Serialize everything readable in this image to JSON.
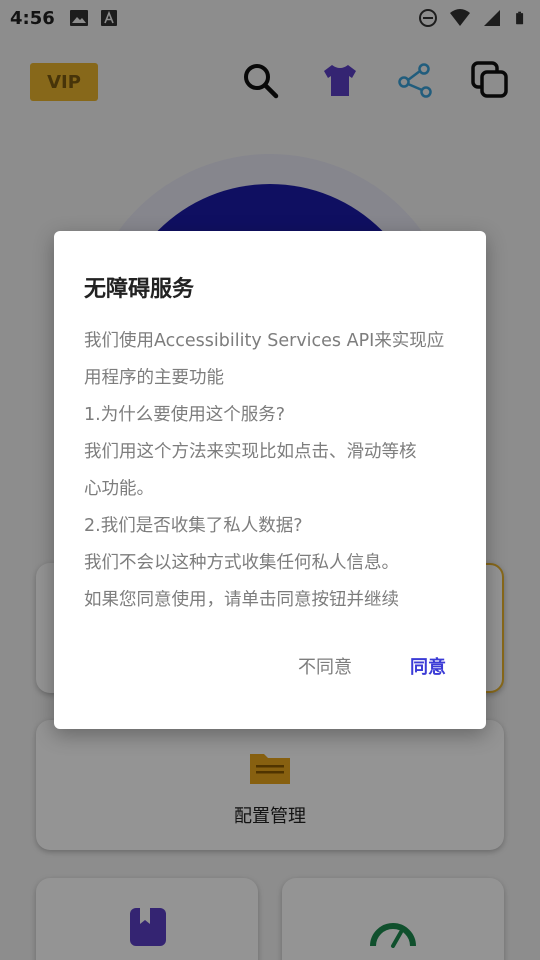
{
  "status_bar": {
    "time": "4:56"
  },
  "header": {
    "vip_label": "VIP",
    "icons": [
      "search-icon",
      "shirt-icon",
      "share-icon",
      "copy-icon"
    ]
  },
  "cards": {
    "config_label": "配置管理"
  },
  "colors": {
    "accent": "#3b3bd6",
    "vip": "#e8b32d",
    "circle": "#1a1aa8"
  },
  "dialog": {
    "title": "无障碍服务",
    "lines": [
      "我们使用Accessibility Services API来实现应",
      "用程序的主要功能",
      "1.为什么要使用这个服务?",
      "我们用这个方法来实现比如点击、滑动等核",
      "心功能。",
      "2.我们是否收集了私人数据?",
      "我们不会以这种方式收集任何私人信息。",
      "如果您同意使用，请单击同意按钮并继续"
    ],
    "disagree_label": "不同意",
    "agree_label": "同意"
  }
}
